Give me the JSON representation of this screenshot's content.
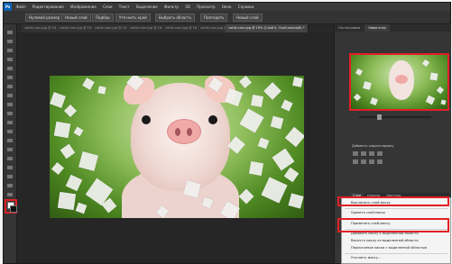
{
  "app": {
    "logo": "Ps"
  },
  "menu": {
    "items": [
      "Файл",
      "Редактирование",
      "Изображение",
      "Слои",
      "Текст",
      "Выделение",
      "Фильтр",
      "3D",
      "Просмотр",
      "Окно",
      "Справка"
    ]
  },
  "options_bar": {
    "buttons": [
      "Нулевой размер",
      "Новый слой",
      "Подбор",
      "Уточнить край",
      "Выбрать область",
      "Повторить",
      "Новый слой"
    ]
  },
  "document_tabs": [
    {
      "label": "cat4k-com.jpg @ 16...",
      "active": false
    },
    {
      "label": "cat4k-com.jpg @ 16...",
      "active": false
    },
    {
      "label": "cat4k-com.jpg @ 16...",
      "active": false
    },
    {
      "label": "cat4k-com.jpg @ 16...",
      "active": false
    },
    {
      "label": "cat4k-com.jpg @ 16...",
      "active": false
    },
    {
      "label": "cat4k-com.jpg @ 16...",
      "active": false
    },
    {
      "label": "cat4k-com.jpg @ 16% (Слой 0, Слой-маска/8) *",
      "active": true
    }
  ],
  "panels": {
    "navigator_tabs": [
      "Гистограмма",
      "Навигатор"
    ],
    "adjustments_title": "Добавить корректировку",
    "layers_tabs": [
      "Слои",
      "Каналы",
      "Контуры"
    ]
  },
  "context_menu": {
    "items": [
      "Выключить слой-маску",
      "Удалить слой-маску",
      "Применить слой-маску",
      "Добавить маску к выделенной области",
      "Вычесть маску из выделенной области",
      "Пересечение маски с выделенной областью",
      "Уточнить маску..."
    ]
  },
  "colors": {
    "highlight": "#e21f26",
    "accent": "#0b62b8"
  },
  "icons": [
    "photoshop-logo-icon",
    "move-icon",
    "marquee-icon",
    "lasso-icon",
    "quick-select-icon",
    "crop-icon",
    "eyedropper-icon",
    "healing-icon",
    "brush-icon",
    "stamp-icon",
    "history-brush-icon",
    "eraser-icon",
    "gradient-icon",
    "blur-icon",
    "dodge-icon",
    "pen-icon",
    "type-icon",
    "path-select-icon",
    "shape-icon",
    "hand-icon",
    "zoom-icon"
  ]
}
